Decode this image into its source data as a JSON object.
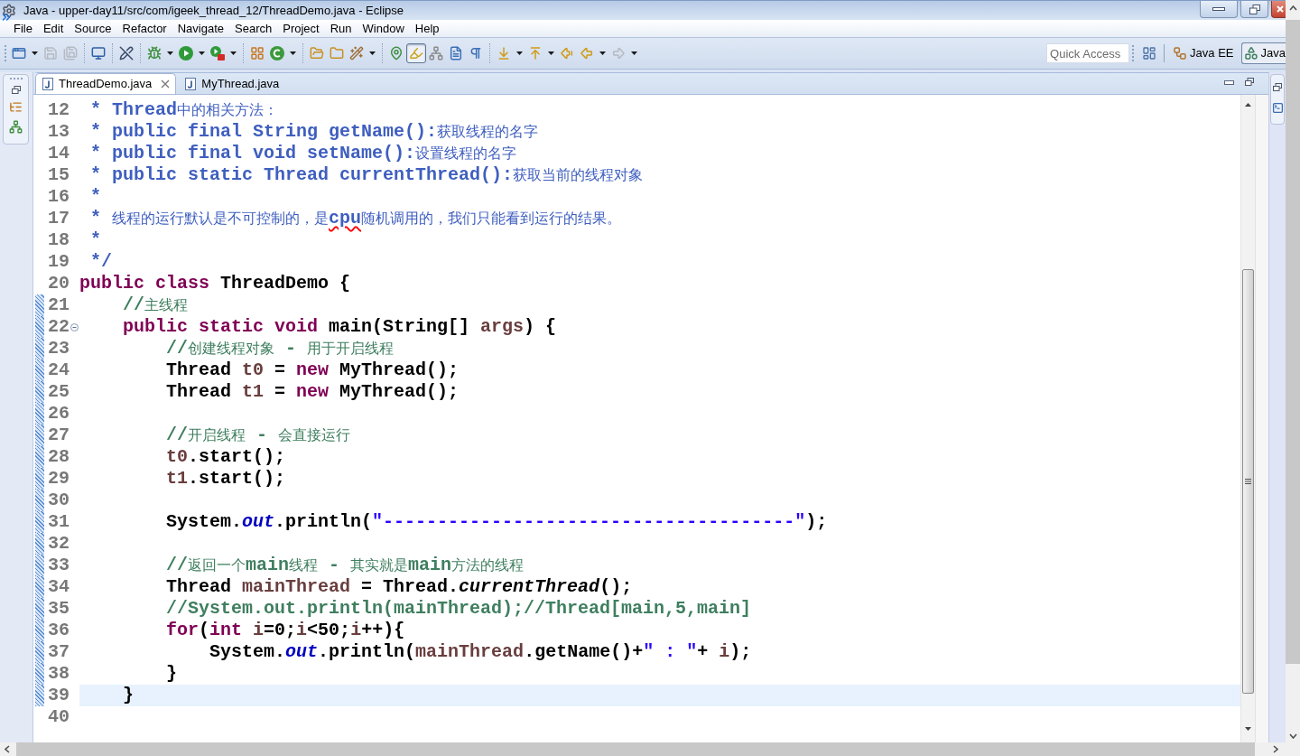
{
  "window": {
    "title": "Java - upper-day11/src/com/igeek_thread_12/ThreadDemo.java - Eclipse"
  },
  "menu": [
    "File",
    "Edit",
    "Source",
    "Refactor",
    "Navigate",
    "Search",
    "Project",
    "Run",
    "Window",
    "Help"
  ],
  "toolbar": {
    "buttons": [
      {
        "disabled": false,
        "pressed": false,
        "menu": true
      },
      {
        "disabled": true,
        "pressed": false,
        "menu": false
      },
      {
        "disabled": true,
        "pressed": false,
        "menu": false
      },
      {
        "disabled": false,
        "pressed": false,
        "menu": false
      },
      {
        "disabled": false,
        "pressed": false,
        "menu": false
      },
      {
        "disabled": false,
        "pressed": false,
        "menu": true
      },
      {
        "disabled": false,
        "pressed": false,
        "menu": true
      },
      {
        "disabled": false,
        "pressed": false,
        "menu": true
      },
      {
        "disabled": false,
        "pressed": false,
        "menu": false
      },
      {
        "disabled": false,
        "pressed": false,
        "menu": true
      },
      {
        "disabled": false,
        "pressed": false,
        "menu": false
      },
      {
        "disabled": false,
        "pressed": false,
        "menu": false
      },
      {
        "disabled": false,
        "pressed": false,
        "menu": true
      },
      {
        "disabled": false,
        "pressed": false,
        "menu": false
      },
      {
        "disabled": false,
        "pressed": true,
        "menu": false
      },
      {
        "disabled": false,
        "pressed": false,
        "menu": false
      },
      {
        "disabled": false,
        "pressed": false,
        "menu": false
      },
      {
        "disabled": false,
        "pressed": false,
        "menu": false
      },
      {
        "disabled": false,
        "pressed": false,
        "menu": true
      },
      {
        "disabled": false,
        "pressed": false,
        "menu": true
      },
      {
        "disabled": false,
        "pressed": false,
        "menu": false
      },
      {
        "disabled": false,
        "pressed": false,
        "menu": true
      },
      {
        "disabled": true,
        "pressed": false,
        "menu": true
      }
    ],
    "quick_access": {
      "placeholder": "Quick Access"
    },
    "perspectives": [
      {
        "label": "Java EE",
        "selected": false
      },
      {
        "label": "Java",
        "selected": true
      }
    ]
  },
  "editor": {
    "tabs": [
      {
        "label": "ThreadDemo.java",
        "selected": true
      },
      {
        "label": "MyThread.java",
        "selected": false
      }
    ],
    "lines": [
      {
        "number": "12",
        "changed": false,
        "current": false,
        "fold": false,
        "tokens": [
          {
            "kind": "javadoc",
            "text": " * Thread中的相关方法："
          }
        ]
      },
      {
        "number": "13",
        "changed": false,
        "current": false,
        "fold": false,
        "tokens": [
          {
            "kind": "javadoc",
            "text": " * public final String getName():获取线程的名字"
          }
        ]
      },
      {
        "number": "14",
        "changed": false,
        "current": false,
        "fold": false,
        "tokens": [
          {
            "kind": "javadoc",
            "text": " * public final void setName():设置线程的名字"
          }
        ]
      },
      {
        "number": "15",
        "changed": false,
        "current": false,
        "fold": false,
        "tokens": [
          {
            "kind": "javadoc",
            "text": " * public static Thread currentThread():获取当前的线程对象"
          }
        ]
      },
      {
        "number": "16",
        "changed": false,
        "current": false,
        "fold": false,
        "tokens": [
          {
            "kind": "javadoc",
            "text": " *"
          }
        ]
      },
      {
        "number": "17",
        "changed": false,
        "current": false,
        "fold": false,
        "tokens": [
          {
            "kind": "javadoc",
            "text": " * 线程的运行默认是不可控制的，是"
          },
          {
            "kind": "typo",
            "text": "cpu"
          },
          {
            "kind": "javadoc",
            "text": "随机调用的，我们只能看到运行的结果。"
          }
        ]
      },
      {
        "number": "18",
        "changed": false,
        "current": false,
        "fold": false,
        "tokens": [
          {
            "kind": "javadoc",
            "text": " *"
          }
        ]
      },
      {
        "number": "19",
        "changed": false,
        "current": false,
        "fold": false,
        "tokens": [
          {
            "kind": "javadoc",
            "text": " */"
          }
        ]
      },
      {
        "number": "20",
        "changed": false,
        "current": false,
        "fold": false,
        "tokens": [
          {
            "kind": "keyword",
            "text": "public class"
          },
          {
            "kind": "plain",
            "text": " ThreadDemo {"
          }
        ]
      },
      {
        "number": "21",
        "changed": true,
        "current": false,
        "fold": false,
        "tokens": [
          {
            "kind": "comment",
            "text": "    //主线程"
          }
        ]
      },
      {
        "number": "22",
        "changed": true,
        "current": false,
        "fold": true,
        "tokens": [
          {
            "kind": "keyword",
            "text": "    public static void"
          },
          {
            "kind": "plain",
            "text": " main(String[] "
          },
          {
            "kind": "local",
            "text": "args"
          },
          {
            "kind": "plain",
            "text": ") {"
          }
        ]
      },
      {
        "number": "23",
        "changed": true,
        "current": false,
        "fold": false,
        "tokens": [
          {
            "kind": "comment",
            "text": "        //创建线程对象 - 用于开启线程"
          }
        ]
      },
      {
        "number": "24",
        "changed": true,
        "current": false,
        "fold": false,
        "tokens": [
          {
            "kind": "plain",
            "text": "        Thread "
          },
          {
            "kind": "local",
            "text": "t0"
          },
          {
            "kind": "plain",
            "text": " = "
          },
          {
            "kind": "keyword",
            "text": "new"
          },
          {
            "kind": "plain",
            "text": " MyThread();"
          }
        ]
      },
      {
        "number": "25",
        "changed": true,
        "current": false,
        "fold": false,
        "tokens": [
          {
            "kind": "plain",
            "text": "        Thread "
          },
          {
            "kind": "local",
            "text": "t1"
          },
          {
            "kind": "plain",
            "text": " = "
          },
          {
            "kind": "keyword",
            "text": "new"
          },
          {
            "kind": "plain",
            "text": " MyThread();"
          }
        ]
      },
      {
        "number": "26",
        "changed": true,
        "current": false,
        "fold": false
      },
      {
        "number": "27",
        "changed": true,
        "current": false,
        "fold": false,
        "tokens": [
          {
            "kind": "comment",
            "text": "        //开启线程 - 会直接运行"
          }
        ]
      },
      {
        "number": "28",
        "changed": true,
        "current": false,
        "fold": false,
        "tokens": [
          {
            "kind": "local",
            "text": "        t0"
          },
          {
            "kind": "plain",
            "text": ".start();"
          }
        ]
      },
      {
        "number": "29",
        "changed": true,
        "current": false,
        "fold": false,
        "tokens": [
          {
            "kind": "local",
            "text": "        t1"
          },
          {
            "kind": "plain",
            "text": ".start();"
          }
        ]
      },
      {
        "number": "30",
        "changed": true,
        "current": false,
        "fold": false
      },
      {
        "number": "31",
        "changed": true,
        "current": false,
        "fold": false,
        "tokens": [
          {
            "kind": "plain",
            "text": "        System."
          },
          {
            "kind": "field",
            "text": "out"
          },
          {
            "kind": "plain",
            "text": ".println("
          },
          {
            "kind": "string",
            "text": "\"--------------------------------------\""
          },
          {
            "kind": "plain",
            "text": ");"
          }
        ]
      },
      {
        "number": "32",
        "changed": true,
        "current": false,
        "fold": false
      },
      {
        "number": "33",
        "changed": true,
        "current": false,
        "fold": false,
        "tokens": [
          {
            "kind": "comment",
            "text": "        //返回一个main线程 - 其实就是main方法的线程"
          }
        ]
      },
      {
        "number": "34",
        "changed": true,
        "current": false,
        "fold": false,
        "tokens": [
          {
            "kind": "plain",
            "text": "        Thread "
          },
          {
            "kind": "local",
            "text": "mainThread"
          },
          {
            "kind": "plain",
            "text": " = Thread."
          },
          {
            "kind": "static_method",
            "text": "currentThread"
          },
          {
            "kind": "plain",
            "text": "();"
          }
        ]
      },
      {
        "number": "35",
        "changed": true,
        "current": false,
        "fold": false,
        "tokens": [
          {
            "kind": "comment",
            "text": "        //System.out.println(mainThread);//Thread[main,5,main]"
          }
        ]
      },
      {
        "number": "36",
        "changed": true,
        "current": false,
        "fold": false,
        "tokens": [
          {
            "kind": "keyword",
            "text": "        for"
          },
          {
            "kind": "plain",
            "text": "("
          },
          {
            "kind": "keyword",
            "text": "int"
          },
          {
            "kind": "local",
            "text": " i"
          },
          {
            "kind": "plain",
            "text": "=0;"
          },
          {
            "kind": "local",
            "text": "i"
          },
          {
            "kind": "plain",
            "text": "<50;"
          },
          {
            "kind": "local",
            "text": "i"
          },
          {
            "kind": "plain",
            "text": "++){"
          }
        ]
      },
      {
        "number": "37",
        "changed": true,
        "current": false,
        "fold": false,
        "tokens": [
          {
            "kind": "plain",
            "text": "            System."
          },
          {
            "kind": "field",
            "text": "out"
          },
          {
            "kind": "plain",
            "text": ".println("
          },
          {
            "kind": "local",
            "text": "mainThread"
          },
          {
            "kind": "plain",
            "text": ".getName()+"
          },
          {
            "kind": "string",
            "text": "\" : \""
          },
          {
            "kind": "plain",
            "text": "+ "
          },
          {
            "kind": "local",
            "text": "i"
          },
          {
            "kind": "plain",
            "text": ");"
          }
        ]
      },
      {
        "number": "38",
        "changed": true,
        "current": false,
        "fold": false,
        "tokens": [
          {
            "kind": "plain",
            "text": "        }"
          }
        ]
      },
      {
        "number": "39",
        "changed": true,
        "current": true,
        "fold": false,
        "tokens": [
          {
            "kind": "plain",
            "text": "    }"
          }
        ]
      },
      {
        "number": "40",
        "changed": false,
        "current": false,
        "fold": false
      }
    ]
  }
}
